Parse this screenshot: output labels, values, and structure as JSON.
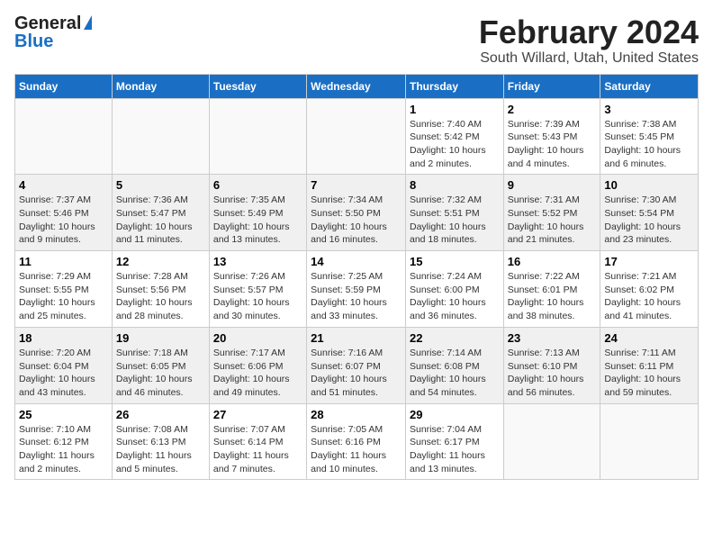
{
  "header": {
    "logo_general": "General",
    "logo_blue": "Blue",
    "month": "February 2024",
    "location": "South Willard, Utah, United States"
  },
  "days_of_week": [
    "Sunday",
    "Monday",
    "Tuesday",
    "Wednesday",
    "Thursday",
    "Friday",
    "Saturday"
  ],
  "weeks": [
    [
      {
        "day": "",
        "info": ""
      },
      {
        "day": "",
        "info": ""
      },
      {
        "day": "",
        "info": ""
      },
      {
        "day": "",
        "info": ""
      },
      {
        "day": "1",
        "info": "Sunrise: 7:40 AM\nSunset: 5:42 PM\nDaylight: 10 hours\nand 2 minutes."
      },
      {
        "day": "2",
        "info": "Sunrise: 7:39 AM\nSunset: 5:43 PM\nDaylight: 10 hours\nand 4 minutes."
      },
      {
        "day": "3",
        "info": "Sunrise: 7:38 AM\nSunset: 5:45 PM\nDaylight: 10 hours\nand 6 minutes."
      }
    ],
    [
      {
        "day": "4",
        "info": "Sunrise: 7:37 AM\nSunset: 5:46 PM\nDaylight: 10 hours\nand 9 minutes."
      },
      {
        "day": "5",
        "info": "Sunrise: 7:36 AM\nSunset: 5:47 PM\nDaylight: 10 hours\nand 11 minutes."
      },
      {
        "day": "6",
        "info": "Sunrise: 7:35 AM\nSunset: 5:49 PM\nDaylight: 10 hours\nand 13 minutes."
      },
      {
        "day": "7",
        "info": "Sunrise: 7:34 AM\nSunset: 5:50 PM\nDaylight: 10 hours\nand 16 minutes."
      },
      {
        "day": "8",
        "info": "Sunrise: 7:32 AM\nSunset: 5:51 PM\nDaylight: 10 hours\nand 18 minutes."
      },
      {
        "day": "9",
        "info": "Sunrise: 7:31 AM\nSunset: 5:52 PM\nDaylight: 10 hours\nand 21 minutes."
      },
      {
        "day": "10",
        "info": "Sunrise: 7:30 AM\nSunset: 5:54 PM\nDaylight: 10 hours\nand 23 minutes."
      }
    ],
    [
      {
        "day": "11",
        "info": "Sunrise: 7:29 AM\nSunset: 5:55 PM\nDaylight: 10 hours\nand 25 minutes."
      },
      {
        "day": "12",
        "info": "Sunrise: 7:28 AM\nSunset: 5:56 PM\nDaylight: 10 hours\nand 28 minutes."
      },
      {
        "day": "13",
        "info": "Sunrise: 7:26 AM\nSunset: 5:57 PM\nDaylight: 10 hours\nand 30 minutes."
      },
      {
        "day": "14",
        "info": "Sunrise: 7:25 AM\nSunset: 5:59 PM\nDaylight: 10 hours\nand 33 minutes."
      },
      {
        "day": "15",
        "info": "Sunrise: 7:24 AM\nSunset: 6:00 PM\nDaylight: 10 hours\nand 36 minutes."
      },
      {
        "day": "16",
        "info": "Sunrise: 7:22 AM\nSunset: 6:01 PM\nDaylight: 10 hours\nand 38 minutes."
      },
      {
        "day": "17",
        "info": "Sunrise: 7:21 AM\nSunset: 6:02 PM\nDaylight: 10 hours\nand 41 minutes."
      }
    ],
    [
      {
        "day": "18",
        "info": "Sunrise: 7:20 AM\nSunset: 6:04 PM\nDaylight: 10 hours\nand 43 minutes."
      },
      {
        "day": "19",
        "info": "Sunrise: 7:18 AM\nSunset: 6:05 PM\nDaylight: 10 hours\nand 46 minutes."
      },
      {
        "day": "20",
        "info": "Sunrise: 7:17 AM\nSunset: 6:06 PM\nDaylight: 10 hours\nand 49 minutes."
      },
      {
        "day": "21",
        "info": "Sunrise: 7:16 AM\nSunset: 6:07 PM\nDaylight: 10 hours\nand 51 minutes."
      },
      {
        "day": "22",
        "info": "Sunrise: 7:14 AM\nSunset: 6:08 PM\nDaylight: 10 hours\nand 54 minutes."
      },
      {
        "day": "23",
        "info": "Sunrise: 7:13 AM\nSunset: 6:10 PM\nDaylight: 10 hours\nand 56 minutes."
      },
      {
        "day": "24",
        "info": "Sunrise: 7:11 AM\nSunset: 6:11 PM\nDaylight: 10 hours\nand 59 minutes."
      }
    ],
    [
      {
        "day": "25",
        "info": "Sunrise: 7:10 AM\nSunset: 6:12 PM\nDaylight: 11 hours\nand 2 minutes."
      },
      {
        "day": "26",
        "info": "Sunrise: 7:08 AM\nSunset: 6:13 PM\nDaylight: 11 hours\nand 5 minutes."
      },
      {
        "day": "27",
        "info": "Sunrise: 7:07 AM\nSunset: 6:14 PM\nDaylight: 11 hours\nand 7 minutes."
      },
      {
        "day": "28",
        "info": "Sunrise: 7:05 AM\nSunset: 6:16 PM\nDaylight: 11 hours\nand 10 minutes."
      },
      {
        "day": "29",
        "info": "Sunrise: 7:04 AM\nSunset: 6:17 PM\nDaylight: 11 hours\nand 13 minutes."
      },
      {
        "day": "",
        "info": ""
      },
      {
        "day": "",
        "info": ""
      }
    ]
  ]
}
